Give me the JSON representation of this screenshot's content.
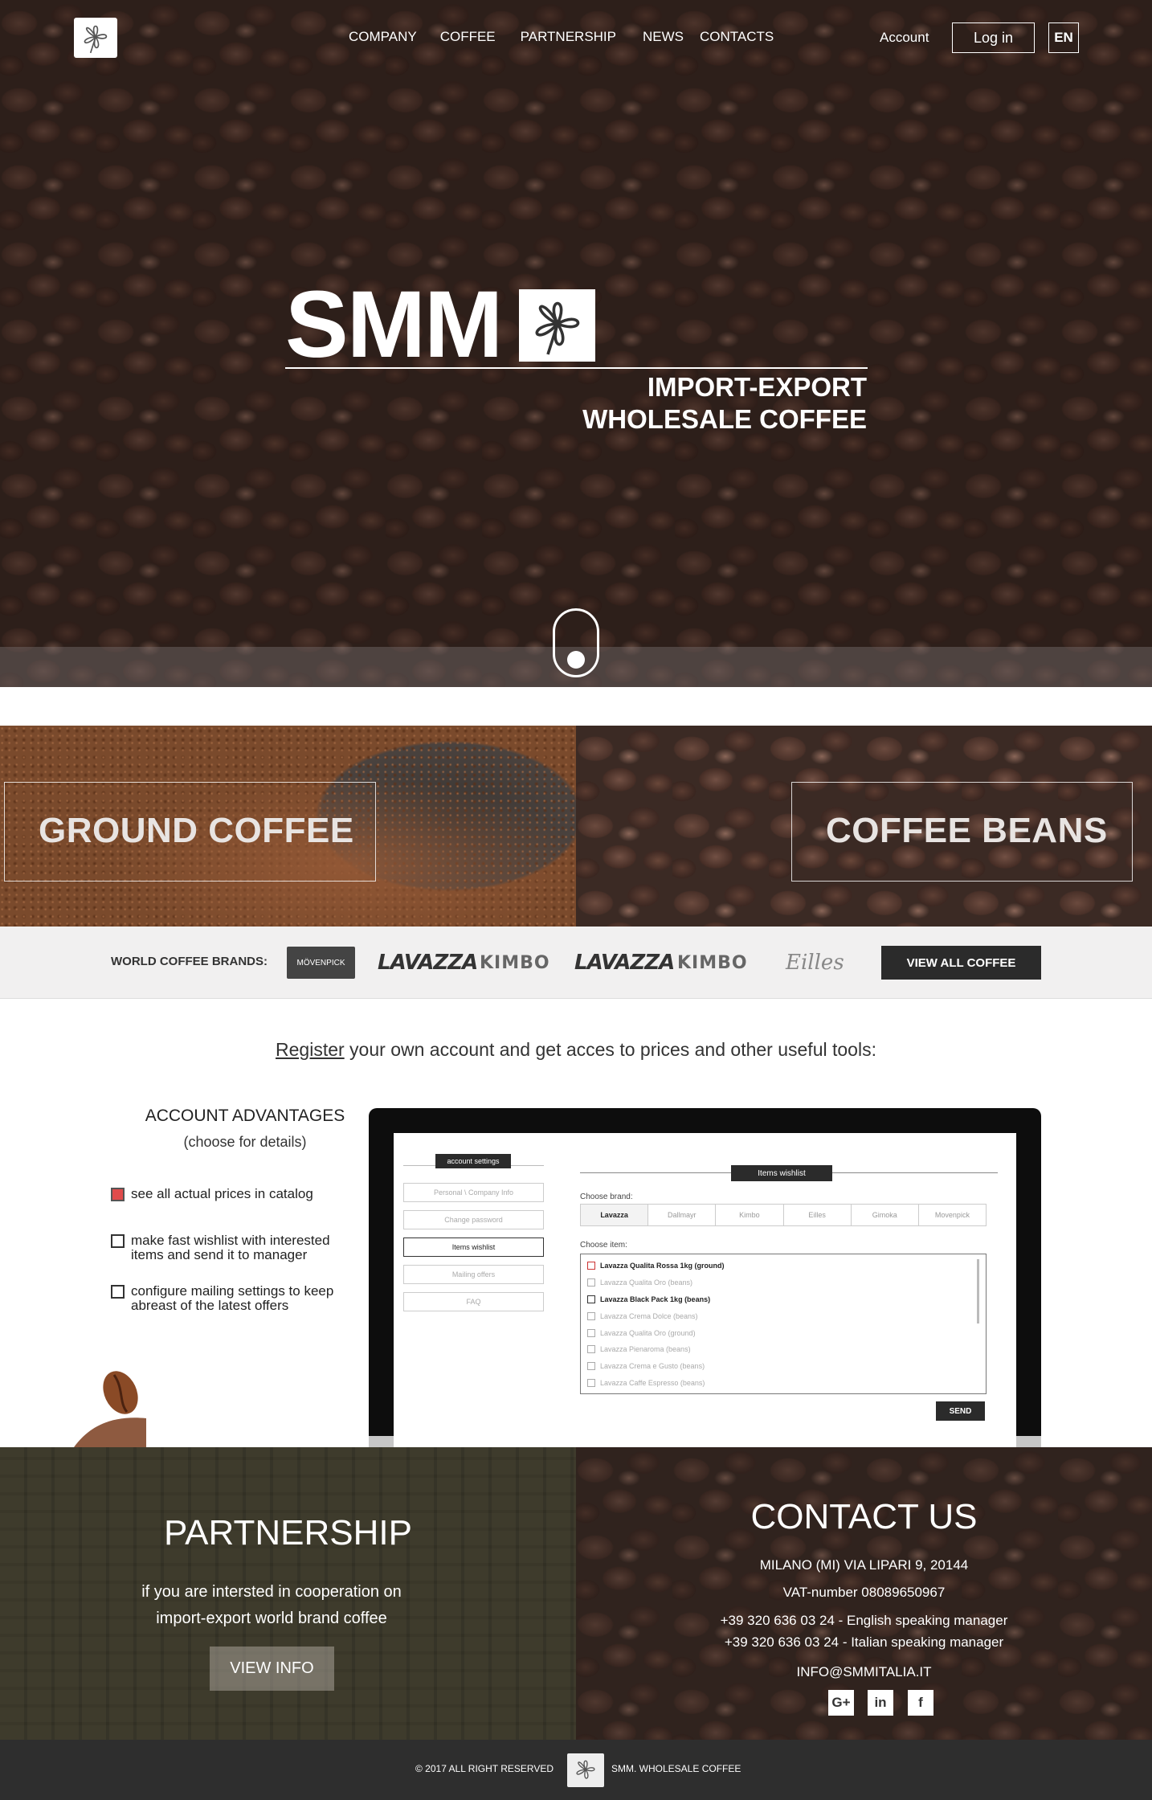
{
  "header": {
    "nav": [
      "COMPANY",
      "COFFEE",
      "PARTNERSHIP",
      "NEWS",
      "CONTACTS"
    ],
    "account": "Account",
    "login": "Log in",
    "lang": "EN"
  },
  "hero": {
    "brand": "SMM",
    "tagline_1": "IMPORT-EXPORT",
    "tagline_2": "WHOLESALE COFFEE"
  },
  "categories": {
    "ground": "GROUND COFFEE",
    "beans": "COFFEE BEANS"
  },
  "brands": {
    "label": "WORLD COFFEE BRANDS:",
    "logos": [
      "MÖVENPICK",
      "LAVAZZA",
      "KIMBO",
      "LAVAZZA",
      "KIMBO",
      "Eilles"
    ],
    "view_all": "VIEW ALL COFFEE"
  },
  "register": {
    "link": "Register",
    "text": " your own account and get acces to prices and other useful tools:"
  },
  "advantages": {
    "title": "ACCOUNT ADVANTAGES",
    "subtitle": "(choose for details)",
    "items": [
      {
        "label": "see all actual prices in catalog",
        "checked": true
      },
      {
        "label": "make fast wishlist with interested items and send it to manager",
        "checked": false
      },
      {
        "label": "configure mailing settings to keep abreast of the latest offers",
        "checked": false
      }
    ]
  },
  "screen": {
    "settings_title": "account settings",
    "menu": [
      "Personal \\ Company Info",
      "Change password",
      "Items wishlist",
      "Mailing offers",
      "FAQ"
    ],
    "wishlist_title": "Items wishlist",
    "choose_brand": "Choose brand:",
    "brands": [
      "Lavazza",
      "Dallmayr",
      "Kimbo",
      "Eilles",
      "Gimoka",
      "Movenpick"
    ],
    "choose_item": "Choose item:",
    "items": [
      "Lavazza Qualita Rossa 1kg (ground)",
      "Lavazza Qualita Oro (beans)",
      "Lavazza Black Pack 1kg (beans)",
      "Lavazza Crema Dolce (beans)",
      "Lavazza Qualita Oro (ground)",
      "Lavazza Pienaroma (beans)",
      "Lavazza Crema e Gusto (beans)",
      "Lavazza Caffe Espresso (beans)"
    ],
    "send": "SEND"
  },
  "partnership": {
    "title": "PARTNERSHIP",
    "text": "if you are intersted in cooperation on import-export world brand coffee",
    "button": "VIEW INFO"
  },
  "contact": {
    "title": "CONTACT US",
    "address": "MILANO (MI) VIA LIPARI 9, 20144",
    "vat": "VAT-number 08089650967",
    "phone_en": "+39 320 636 03 24 - English speaking manager",
    "phone_it": "+39 320 636 03 24 - Italian speaking manager",
    "email": "INFO@SMMITALIA.IT",
    "social": [
      "G+",
      "in",
      "f"
    ]
  },
  "footer": {
    "copyright": "© 2017 ALL RIGHT RESERVED",
    "brand": "SMM. WHOLESALE COFFEE"
  }
}
